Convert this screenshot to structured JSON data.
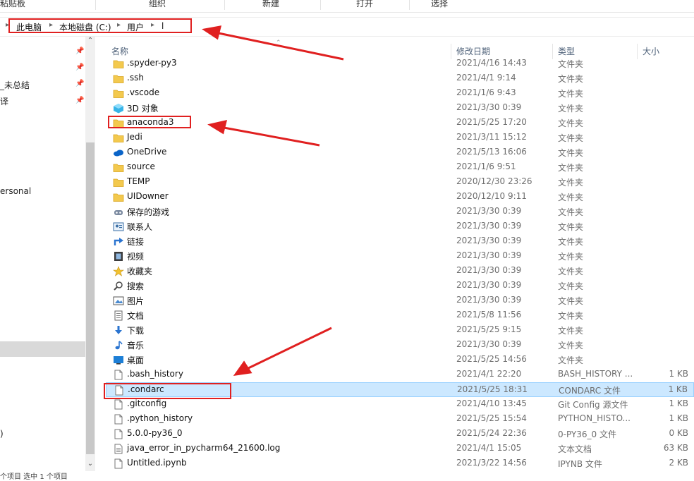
{
  "ribbon": {
    "groups": [
      "粘贴板",
      "组织",
      "新建",
      "打开",
      "选择"
    ]
  },
  "breadcrumb": [
    "此电脑",
    "本地磁盘 (C:)",
    "用户",
    "l"
  ],
  "nav": {
    "items": [
      {
        "label": "_未总结",
        "pinned": true
      },
      {
        "label": "译",
        "pinned": true
      },
      {
        "label": "ersonal",
        "pinned": false
      },
      {
        "label": ")",
        "pinned": false
      }
    ],
    "status": "个项目 选中 1 个项目"
  },
  "columns": {
    "name": "名称",
    "date": "修改日期",
    "type": "类型",
    "size": "大小"
  },
  "files": [
    {
      "icon": "folder",
      "name": ".spyder-py3",
      "date": "2021/4/16 14:43",
      "type": "文件夹",
      "size": ""
    },
    {
      "icon": "folder",
      "name": ".ssh",
      "date": "2021/4/1 9:14",
      "type": "文件夹",
      "size": ""
    },
    {
      "icon": "folder",
      "name": ".vscode",
      "date": "2021/1/6 9:43",
      "type": "文件夹",
      "size": ""
    },
    {
      "icon": "3d-objects",
      "name": "3D 对象",
      "date": "2021/3/30 0:39",
      "type": "文件夹",
      "size": ""
    },
    {
      "icon": "folder",
      "name": "anaconda3",
      "date": "2021/5/25 17:20",
      "type": "文件夹",
      "size": ""
    },
    {
      "icon": "folder",
      "name": "Jedi",
      "date": "2021/3/11 15:12",
      "type": "文件夹",
      "size": ""
    },
    {
      "icon": "onedrive",
      "name": "OneDrive",
      "date": "2021/5/13 16:06",
      "type": "文件夹",
      "size": ""
    },
    {
      "icon": "folder",
      "name": "source",
      "date": "2021/1/6 9:51",
      "type": "文件夹",
      "size": ""
    },
    {
      "icon": "folder",
      "name": "TEMP",
      "date": "2020/12/30 23:26",
      "type": "文件夹",
      "size": ""
    },
    {
      "icon": "folder",
      "name": "UIDowner",
      "date": "2020/12/10 9:11",
      "type": "文件夹",
      "size": ""
    },
    {
      "icon": "saved-games",
      "name": "保存的游戏",
      "date": "2021/3/30 0:39",
      "type": "文件夹",
      "size": ""
    },
    {
      "icon": "contacts",
      "name": "联系人",
      "date": "2021/3/30 0:39",
      "type": "文件夹",
      "size": ""
    },
    {
      "icon": "links",
      "name": "链接",
      "date": "2021/3/30 0:39",
      "type": "文件夹",
      "size": ""
    },
    {
      "icon": "videos",
      "name": "视频",
      "date": "2021/3/30 0:39",
      "type": "文件夹",
      "size": ""
    },
    {
      "icon": "favorites",
      "name": "收藏夹",
      "date": "2021/3/30 0:39",
      "type": "文件夹",
      "size": ""
    },
    {
      "icon": "searches",
      "name": "搜索",
      "date": "2021/3/30 0:39",
      "type": "文件夹",
      "size": ""
    },
    {
      "icon": "pictures",
      "name": "图片",
      "date": "2021/3/30 0:39",
      "type": "文件夹",
      "size": ""
    },
    {
      "icon": "documents",
      "name": "文档",
      "date": "2021/5/8 11:56",
      "type": "文件夹",
      "size": ""
    },
    {
      "icon": "downloads",
      "name": "下载",
      "date": "2021/5/25 9:15",
      "type": "文件夹",
      "size": ""
    },
    {
      "icon": "music",
      "name": "音乐",
      "date": "2021/3/30 0:39",
      "type": "文件夹",
      "size": ""
    },
    {
      "icon": "desktop",
      "name": "桌面",
      "date": "2021/5/25 14:56",
      "type": "文件夹",
      "size": ""
    },
    {
      "icon": "file",
      "name": ".bash_history",
      "date": "2021/4/1 22:20",
      "type": "BASH_HISTORY ...",
      "size": "1 KB"
    },
    {
      "icon": "file",
      "name": ".condarc",
      "date": "2021/5/25 18:31",
      "type": "CONDARC 文件",
      "size": "1 KB",
      "selected": true
    },
    {
      "icon": "file",
      "name": ".gitconfig",
      "date": "2021/4/10 13:45",
      "type": "Git Config 源文件",
      "size": "1 KB"
    },
    {
      "icon": "file",
      "name": ".python_history",
      "date": "2021/5/25 15:54",
      "type": "PYTHON_HISTO...",
      "size": "1 KB"
    },
    {
      "icon": "file",
      "name": "5.0.0-py36_0",
      "date": "2021/5/24 22:36",
      "type": "0-PY36_0 文件",
      "size": "0 KB"
    },
    {
      "icon": "text-file",
      "name": "java_error_in_pycharm64_21600.log",
      "date": "2021/4/1 15:05",
      "type": "文本文档",
      "size": "63 KB"
    },
    {
      "icon": "file",
      "name": "Untitled.ipynb",
      "date": "2021/3/22 14:56",
      "type": "IPYNB 文件",
      "size": "2 KB"
    }
  ],
  "colors": {
    "annotation": "#e02020",
    "folder": "#f3c94e",
    "selection": "#cce8ff"
  }
}
